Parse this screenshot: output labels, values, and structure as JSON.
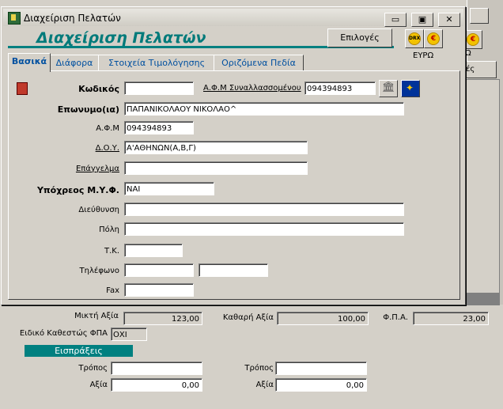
{
  "window": {
    "title": "Διαχείριση Πελατών",
    "controls": [
      "▭",
      "▣",
      "✕"
    ]
  },
  "header": {
    "form_title": "Διαχείριση Πελατών",
    "options_label": "Επιλογές",
    "drx_label": "DRX",
    "euro_symbol": "€",
    "currency_label": "ΕΥΡΩ"
  },
  "tabs": [
    {
      "label": "Βασικά",
      "active": true
    },
    {
      "label": "Διάφορα",
      "active": false
    },
    {
      "label": "Στοιχεία Τιμολόγησης",
      "active": false
    },
    {
      "label": "Οριζόμενα Πεδία",
      "active": false
    }
  ],
  "form": {
    "code": {
      "label": "Κωδικός",
      "value": ""
    },
    "transactor_afm": {
      "label": "Α.Φ.Μ Συναλλασσομένου",
      "value": "094394893"
    },
    "surname": {
      "label": "Επωνυμο(ια)",
      "value": "ΠΑΠΑΝΙΚΟΛΑΟΥ ΝΙΚΟΛΑΟ^"
    },
    "afm": {
      "label": "Α.Φ.Μ",
      "value": "094394893"
    },
    "doy": {
      "label": "Δ.Ο.Υ.",
      "value": "Α'ΑΘΗΝΩΝ(Α,Β,Γ)"
    },
    "profession": {
      "label": "Επάγγελμα",
      "value": ""
    },
    "vat_obligated": {
      "label": "Υπόχρεος Μ.Υ.Φ.",
      "value": "ΝΑΙ"
    },
    "address": {
      "label": "Διεύθυνση",
      "value": ""
    },
    "city": {
      "label": "Πόλη",
      "value": ""
    },
    "postal_code": {
      "label": "Τ.Κ.",
      "value": ""
    },
    "phone": {
      "label": "Τηλέφωνο",
      "value1": "",
      "value2": ""
    },
    "fax": {
      "label": "Fax",
      "value": ""
    }
  },
  "totals": {
    "gross": {
      "label": "Μικτή Αξία",
      "value": "123,00"
    },
    "net": {
      "label": "Καθαρή Αξία",
      "value": "100,00"
    },
    "vat": {
      "label": "Φ.Π.Α.",
      "value": "23,00"
    },
    "vat_status": {
      "label": "Ειδικό Καθεστώς ΦΠΑ",
      "value": "ΟΧΙ"
    }
  },
  "receipts": {
    "header": "Εισπράξεις",
    "left": {
      "method_label": "Τρόπος",
      "method_value": "",
      "amount_label": "Αξία",
      "amount_value": "0,00"
    },
    "right": {
      "method_label": "Τρόπος",
      "method_value": "",
      "amount_label": "Αξία",
      "amount_value": "0,00"
    }
  },
  "background_window": {
    "euro_symbol": "€",
    "letter_omega": "Ω",
    "partial_label": "ές"
  }
}
